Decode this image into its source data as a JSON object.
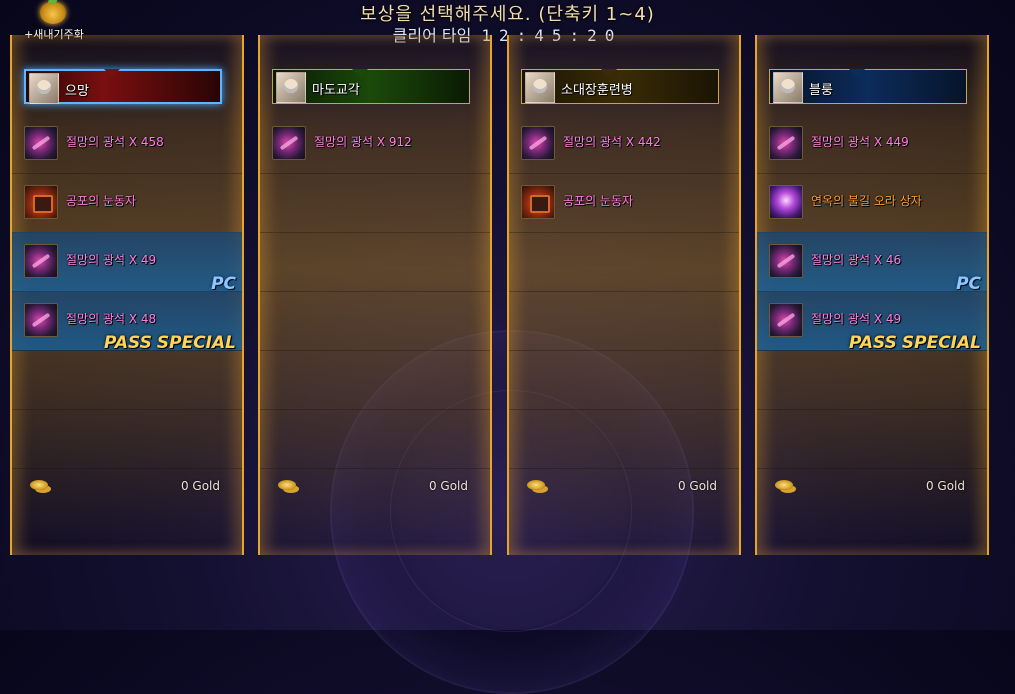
{
  "header": {
    "title": "보상을 선택해주세요. (단축키 1~4)",
    "time_label": "클리어 타임",
    "time_value": "12:45:20"
  },
  "badge": {
    "label": "+새내기주화",
    "icon": "sprout-coin-icon"
  },
  "players": [
    {
      "name": "으망",
      "frame_color": "#7a0f0f",
      "selected": true,
      "rewards": [
        {
          "icon": "despair-stone-icon",
          "name": "절망의 광석 X 458",
          "tag": ""
        },
        {
          "icon": "fear-eye-icon",
          "name": "공포의 눈동자",
          "tag": ""
        },
        {
          "icon": "despair-stone-icon",
          "name": "절망의 광석 X 49",
          "tag": "PC"
        },
        {
          "icon": "despair-stone-icon",
          "name": "절망의 광석 X 48",
          "tag": "PASS SPECIAL"
        }
      ],
      "gold": "0 Gold"
    },
    {
      "name": "마도교각",
      "frame_color": "#1a4a0a",
      "selected": false,
      "rewards": [
        {
          "icon": "despair-stone-icon",
          "name": "절망의 광석 X 912",
          "tag": ""
        }
      ],
      "gold": "0 Gold"
    },
    {
      "name": "소대장훈련병",
      "frame_color": "#3a2c06",
      "selected": false,
      "rewards": [
        {
          "icon": "despair-stone-icon",
          "name": "절망의 광석 X 442",
          "tag": ""
        },
        {
          "icon": "fear-eye-icon",
          "name": "공포의 눈동자",
          "tag": ""
        }
      ],
      "gold": "0 Gold"
    },
    {
      "name": "블룽",
      "frame_color": "#0c2c5a",
      "selected": false,
      "rewards": [
        {
          "icon": "despair-stone-icon",
          "name": "절망의 광석 X 449",
          "tag": ""
        },
        {
          "icon": "purgatory-aura-box-icon",
          "name": "연옥의 불길 오라 상자",
          "tag": ""
        },
        {
          "icon": "despair-stone-icon",
          "name": "절망의 광석 X 46",
          "tag": "PC"
        },
        {
          "icon": "despair-stone-icon",
          "name": "절망의 광석 X 49",
          "tag": "PASS SPECIAL"
        }
      ],
      "gold": "0 Gold"
    }
  ],
  "tags": {
    "pc": "PC",
    "pass_1": "PASS",
    "pass_2": "SPECIAL"
  }
}
